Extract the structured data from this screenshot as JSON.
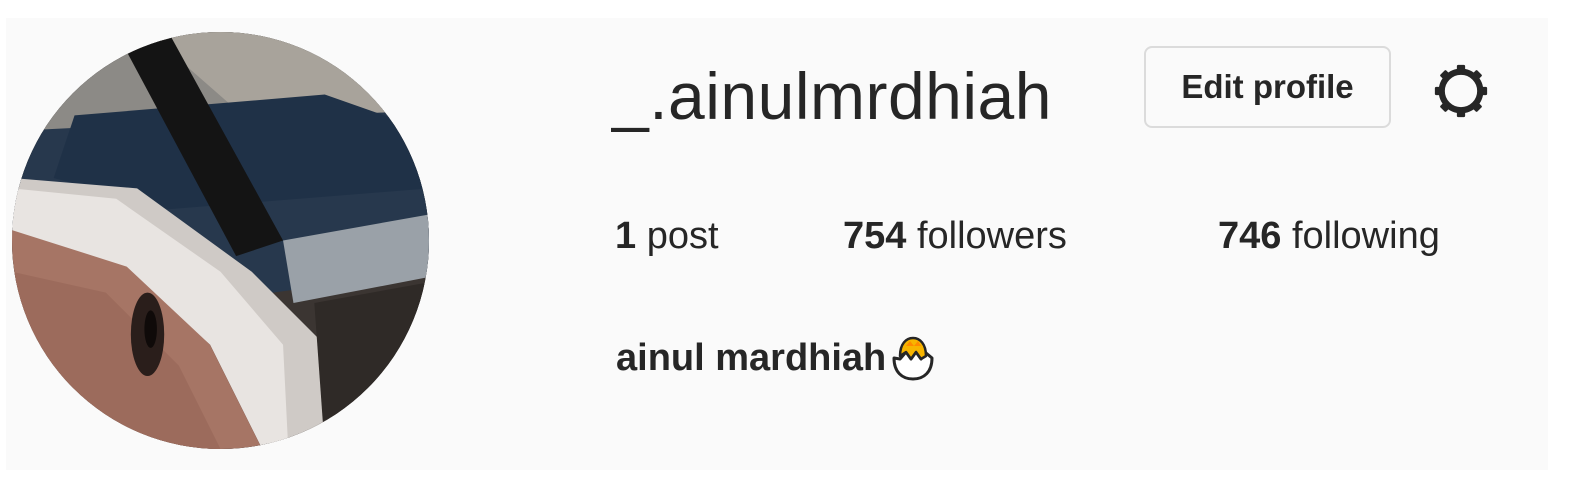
{
  "profile": {
    "username": "_.ainulmrdhiah",
    "full_name": "ainul mardhiah",
    "full_name_emoji": "hatching-chick-emoji",
    "avatar": "profile-photo"
  },
  "actions": {
    "edit_profile_label": "Edit profile",
    "settings_icon": "gear-icon"
  },
  "stats": {
    "posts": {
      "count": "1",
      "label": "post"
    },
    "followers": {
      "count": "754",
      "label": "followers"
    },
    "following": {
      "count": "746",
      "label": "following"
    }
  },
  "colors": {
    "text": "#262626",
    "background": "#fafafa",
    "button_border": "#dbdbdb"
  }
}
